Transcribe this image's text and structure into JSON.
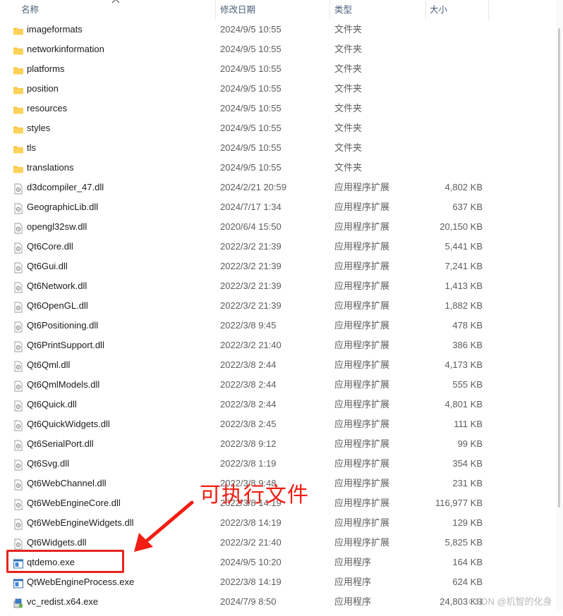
{
  "columns": {
    "name": "名称",
    "date": "修改日期",
    "type": "类型",
    "size": "大小"
  },
  "rows": [
    {
      "name": "imageformats",
      "date": "2024/9/5 10:55",
      "type": "文件夹",
      "size": "",
      "icon": "folder-icon"
    },
    {
      "name": "networkinformation",
      "date": "2024/9/5 10:55",
      "type": "文件夹",
      "size": "",
      "icon": "folder-icon"
    },
    {
      "name": "platforms",
      "date": "2024/9/5 10:55",
      "type": "文件夹",
      "size": "",
      "icon": "folder-icon"
    },
    {
      "name": "position",
      "date": "2024/9/5 10:55",
      "type": "文件夹",
      "size": "",
      "icon": "folder-icon"
    },
    {
      "name": "resources",
      "date": "2024/9/5 10:55",
      "type": "文件夹",
      "size": "",
      "icon": "folder-icon"
    },
    {
      "name": "styles",
      "date": "2024/9/5 10:55",
      "type": "文件夹",
      "size": "",
      "icon": "folder-icon"
    },
    {
      "name": "tls",
      "date": "2024/9/5 10:55",
      "type": "文件夹",
      "size": "",
      "icon": "folder-icon"
    },
    {
      "name": "translations",
      "date": "2024/9/5 10:55",
      "type": "文件夹",
      "size": "",
      "icon": "folder-icon"
    },
    {
      "name": "d3dcompiler_47.dll",
      "date": "2024/2/21 20:59",
      "type": "应用程序扩展",
      "size": "4,802 KB",
      "icon": "dll-file-icon"
    },
    {
      "name": "GeographicLib.dll",
      "date": "2024/7/17 1:34",
      "type": "应用程序扩展",
      "size": "637 KB",
      "icon": "dll-file-icon"
    },
    {
      "name": "opengl32sw.dll",
      "date": "2020/6/4 15:50",
      "type": "应用程序扩展",
      "size": "20,150 KB",
      "icon": "dll-file-icon"
    },
    {
      "name": "Qt6Core.dll",
      "date": "2022/3/2 21:39",
      "type": "应用程序扩展",
      "size": "5,441 KB",
      "icon": "dll-file-icon"
    },
    {
      "name": "Qt6Gui.dll",
      "date": "2022/3/2 21:39",
      "type": "应用程序扩展",
      "size": "7,241 KB",
      "icon": "dll-file-icon"
    },
    {
      "name": "Qt6Network.dll",
      "date": "2022/3/2 21:39",
      "type": "应用程序扩展",
      "size": "1,413 KB",
      "icon": "dll-file-icon"
    },
    {
      "name": "Qt6OpenGL.dll",
      "date": "2022/3/2 21:39",
      "type": "应用程序扩展",
      "size": "1,882 KB",
      "icon": "dll-file-icon"
    },
    {
      "name": "Qt6Positioning.dll",
      "date": "2022/3/8 9:45",
      "type": "应用程序扩展",
      "size": "478 KB",
      "icon": "dll-file-icon"
    },
    {
      "name": "Qt6PrintSupport.dll",
      "date": "2022/3/2 21:40",
      "type": "应用程序扩展",
      "size": "386 KB",
      "icon": "dll-file-icon"
    },
    {
      "name": "Qt6Qml.dll",
      "date": "2022/3/8 2:44",
      "type": "应用程序扩展",
      "size": "4,173 KB",
      "icon": "dll-file-icon"
    },
    {
      "name": "Qt6QmlModels.dll",
      "date": "2022/3/8 2:44",
      "type": "应用程序扩展",
      "size": "555 KB",
      "icon": "dll-file-icon"
    },
    {
      "name": "Qt6Quick.dll",
      "date": "2022/3/8 2:44",
      "type": "应用程序扩展",
      "size": "4,801 KB",
      "icon": "dll-file-icon"
    },
    {
      "name": "Qt6QuickWidgets.dll",
      "date": "2022/3/8 2:45",
      "type": "应用程序扩展",
      "size": "111 KB",
      "icon": "dll-file-icon"
    },
    {
      "name": "Qt6SerialPort.dll",
      "date": "2022/3/8 9:12",
      "type": "应用程序扩展",
      "size": "99 KB",
      "icon": "dll-file-icon"
    },
    {
      "name": "Qt6Svg.dll",
      "date": "2022/3/8 1:19",
      "type": "应用程序扩展",
      "size": "354 KB",
      "icon": "dll-file-icon"
    },
    {
      "name": "Qt6WebChannel.dll",
      "date": "2022/3/8 9:48",
      "type": "应用程序扩展",
      "size": "231 KB",
      "icon": "dll-file-icon"
    },
    {
      "name": "Qt6WebEngineCore.dll",
      "date": "2022/3/8 14:19",
      "type": "应用程序扩展",
      "size": "116,977 KB",
      "icon": "dll-file-icon"
    },
    {
      "name": "Qt6WebEngineWidgets.dll",
      "date": "2022/3/8 14:19",
      "type": "应用程序扩展",
      "size": "129 KB",
      "icon": "dll-file-icon"
    },
    {
      "name": "Qt6Widgets.dll",
      "date": "2022/3/2 21:40",
      "type": "应用程序扩展",
      "size": "5,825 KB",
      "icon": "dll-file-icon"
    },
    {
      "name": "qtdemo.exe",
      "date": "2024/9/5 10:20",
      "type": "应用程序",
      "size": "164 KB",
      "icon": "exe-file-icon"
    },
    {
      "name": "QtWebEngineProcess.exe",
      "date": "2022/3/8 14:19",
      "type": "应用程序",
      "size": "624 KB",
      "icon": "exe-file-icon"
    },
    {
      "name": "vc_redist.x64.exe",
      "date": "2024/7/9 8:50",
      "type": "应用程序",
      "size": "24,803 KB",
      "icon": "installer-icon"
    }
  ],
  "annotation": {
    "text": "可执行文件",
    "color": "#f21d14"
  },
  "watermark": "CSDN @机智的化身"
}
